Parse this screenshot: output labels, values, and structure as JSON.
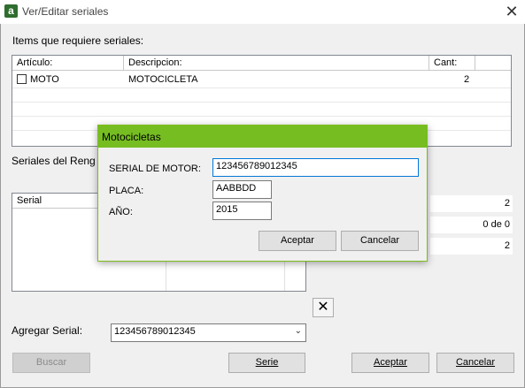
{
  "window": {
    "title": "Ver/Editar seriales",
    "icon_letter": "a"
  },
  "items_section": {
    "label": "Items que requiere seriales:",
    "columns": [
      "Artículo:",
      "Descripcion:",
      "Cant:"
    ],
    "rows": [
      {
        "articulo": "MOTO",
        "descripcion": "MOTOCICLETA",
        "cant": "2"
      }
    ]
  },
  "seriales_section": {
    "label": "Seriales del Reng",
    "column": "Serial",
    "values": [
      "2",
      "0 de 0",
      "2"
    ]
  },
  "agregar": {
    "label": "Agregar Serial:",
    "value": "123456789012345"
  },
  "buttons": {
    "buscar": "Buscar",
    "serie": "Serie",
    "aceptar": "Aceptar",
    "cancelar": "Cancelar"
  },
  "modal": {
    "title": "Motocicletas",
    "serial_label": "SERIAL DE MOTOR:",
    "serial_value": "123456789012345",
    "placa_label": "PLACA:",
    "placa_value": "AABBDD",
    "anio_label": "AÑO:",
    "anio_value": "2015",
    "aceptar": "Aceptar",
    "cancelar": "Cancelar"
  },
  "colors": {
    "modal_title_bg": "#76bd22",
    "accent_border": "#0078d7"
  }
}
